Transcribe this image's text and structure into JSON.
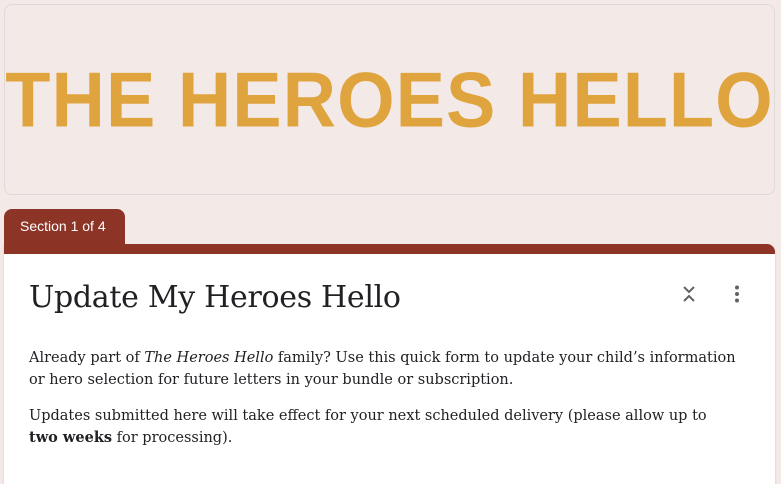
{
  "banner": {
    "title": "THE HEROES HELLO"
  },
  "section": {
    "label": "Section 1 of 4"
  },
  "form": {
    "title": "Update My Heroes Hello",
    "paragraph1": {
      "before": "Already part of ",
      "italic": "The Heroes Hello",
      "after": " family? Use this quick form to update your child’s information or hero selection for future letters in your bundle or subscription."
    },
    "paragraph2": {
      "before": "Updates submitted here will take effect for your next scheduled delivery (please allow up to ",
      "bold": "two weeks",
      "after": " for processing)."
    }
  },
  "icons": {
    "collapse": "collapse-icon",
    "more": "more-vert-icon"
  },
  "colors": {
    "accent": "#8c3426",
    "banner_text": "#e0a43f",
    "background": "#f3e9e7"
  }
}
